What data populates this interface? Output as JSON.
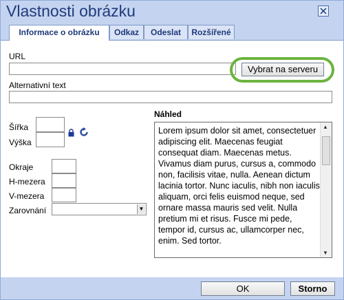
{
  "dialog": {
    "title": "Vlastnosti obrázku",
    "close_icon": "close-x-icon"
  },
  "tabs": [
    {
      "label": "Informace o obrázku",
      "active": true
    },
    {
      "label": "Odkaz",
      "active": false
    },
    {
      "label": "Odeslat",
      "active": false
    },
    {
      "label": "Rozšířené",
      "active": false
    }
  ],
  "form": {
    "url_label": "URL",
    "url_value": "",
    "browse_button": "Vybrat na serveru",
    "alt_label": "Alternativní text",
    "alt_value": "",
    "width_label": "Šířka",
    "width_value": "",
    "height_label": "Výška",
    "height_value": "",
    "lock_icon": "lock-icon",
    "reset_icon": "reset-size-icon",
    "border_label": "Okraje",
    "hspace_label": "H-mezera",
    "vspace_label": "V-mezera",
    "align_label": "Zarovnání",
    "align_value": ""
  },
  "preview": {
    "label": "Náhled",
    "text": "Lorem ipsum dolor sit amet, consectetuer adipiscing elit. Maecenas feugiat consequat diam. Maecenas metus. Vivamus diam purus, cursus a, commodo non, facilisis vitae, nulla. Aenean dictum lacinia tortor. Nunc iaculis, nibh non iaculis aliquam, orci felis euismod neque, sed ornare massa mauris sed velit. Nulla pretium mi et risus. Fusce mi pede, tempor id, cursus ac, ullamcorper nec, enim. Sed tortor."
  },
  "footer": {
    "ok_label": "OK",
    "cancel_label": "Storno"
  },
  "colors": {
    "highlight": "#6db33f",
    "accent": "#c4d4f0"
  }
}
